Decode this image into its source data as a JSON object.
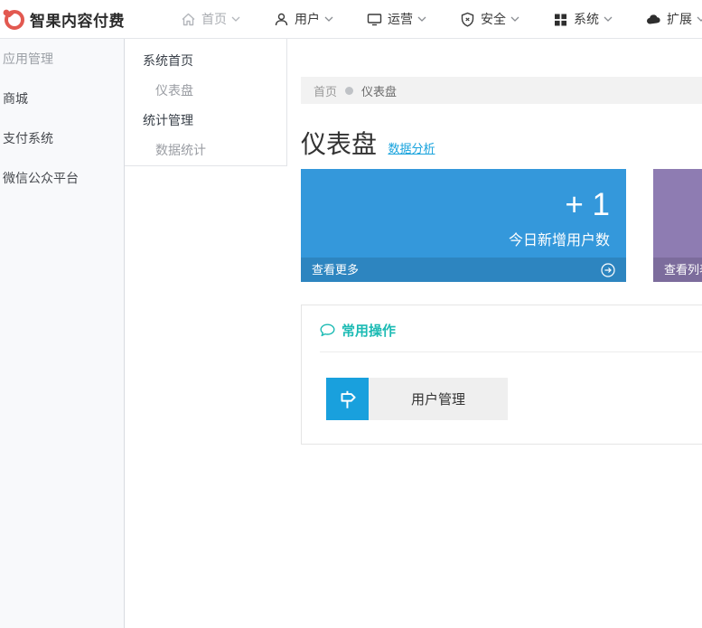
{
  "brand": {
    "name": "智果内容付费"
  },
  "navbar": {
    "items": [
      {
        "label": "首页",
        "icon": "home-icon",
        "muted": true
      },
      {
        "label": "用户",
        "icon": "user-icon",
        "muted": false
      },
      {
        "label": "运营",
        "icon": "monitor-icon",
        "muted": false
      },
      {
        "label": "安全",
        "icon": "shield-icon",
        "muted": false
      },
      {
        "label": "系统",
        "icon": "grid-icon",
        "muted": false
      },
      {
        "label": "扩展",
        "icon": "cloud-icon",
        "muted": false
      }
    ]
  },
  "sidebar": {
    "items": [
      {
        "label": "应用管理",
        "muted": true
      },
      {
        "label": "商城",
        "muted": false
      },
      {
        "label": "支付系统",
        "muted": false
      },
      {
        "label": "微信公众平台",
        "muted": false
      }
    ]
  },
  "submenu": {
    "groups": [
      {
        "label": "系统首页",
        "children": [
          {
            "label": "仪表盘"
          }
        ]
      },
      {
        "label": "统计管理",
        "children": [
          {
            "label": "数据统计"
          }
        ]
      }
    ]
  },
  "breadcrumb": {
    "home": "首页",
    "current": "仪表盘"
  },
  "page": {
    "title": "仪表盘",
    "subtitle_link": "数据分析"
  },
  "stat_cards": [
    {
      "value": "+ 1",
      "label": "今日新增用户数",
      "footer": "查看更多",
      "color": "#3498db"
    },
    {
      "footer": "查看列表",
      "color": "#8e7cb2"
    }
  ],
  "ops_panel": {
    "title": "常用操作",
    "shortcuts": [
      {
        "label": "用户管理"
      }
    ]
  },
  "colors": {
    "brand_red": "#e25950",
    "link_blue": "#18a3dd",
    "card_blue": "#3498db",
    "card_purple": "#8e7cb2",
    "teal": "#1cbbb4",
    "shortcut_icon_blue": "#19a0dd"
  }
}
